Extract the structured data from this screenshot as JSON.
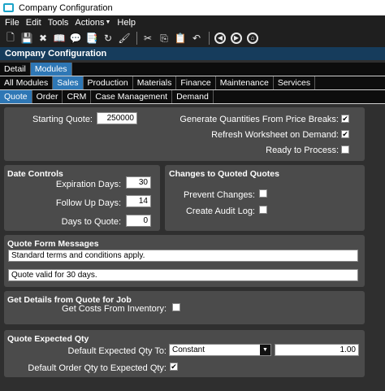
{
  "window": {
    "title": "Company Configuration"
  },
  "menu": [
    "File",
    "Edit",
    "Tools",
    "Actions",
    "Help"
  ],
  "header": {
    "title": "Company Configuration"
  },
  "tabs_level1": [
    {
      "label": "Detail",
      "active": false
    },
    {
      "label": "Modules",
      "active": true
    }
  ],
  "tabs_level2": [
    {
      "label": "All Modules",
      "active": false
    },
    {
      "label": "Sales",
      "active": true
    },
    {
      "label": "Production",
      "active": false
    },
    {
      "label": "Materials",
      "active": false
    },
    {
      "label": "Finance",
      "active": false
    },
    {
      "label": "Maintenance",
      "active": false
    },
    {
      "label": "Services",
      "active": false
    }
  ],
  "tabs_level3": [
    {
      "label": "Quote",
      "active": true
    },
    {
      "label": "Order",
      "active": false
    },
    {
      "label": "CRM",
      "active": false
    },
    {
      "label": "Case Management",
      "active": false
    },
    {
      "label": "Demand",
      "active": false
    }
  ],
  "general": {
    "starting_quote_label": "Starting Quote:",
    "starting_quote_value": "250000",
    "generate_qty_label": "Generate Quantities From Price Breaks:",
    "generate_qty_checked": true,
    "refresh_label": "Refresh Worksheet on Demand:",
    "refresh_checked": true,
    "ready_label": "Ready to Process:",
    "ready_checked": false
  },
  "date_controls": {
    "title": "Date Controls",
    "expiration_label": "Expiration Days:",
    "expiration_value": "30",
    "follow_up_label": "Follow Up Days:",
    "follow_up_value": "14",
    "days_to_quote_label": "Days to Quote:",
    "days_to_quote_value": "0"
  },
  "changes": {
    "title": "Changes to Quoted Quotes",
    "prevent_label": "Prevent Changes:",
    "prevent_checked": false,
    "audit_label": "Create Audit Log:",
    "audit_checked": false
  },
  "messages": {
    "title": "Quote Form Messages",
    "line1": "Standard terms and conditions apply.",
    "line2": "Quote valid for 30 days."
  },
  "details": {
    "title": "Get Details from Quote for Job",
    "costs_label": "Get Costs From Inventory:",
    "costs_checked": false
  },
  "expected": {
    "title": "Quote Expected Qty",
    "default_to_label": "Default Expected Qty To:",
    "default_to_value": "Constant",
    "constant_value": "1.00",
    "order_qty_label": "Default Order Qty to Expected Qty:",
    "order_qty_checked": true
  }
}
